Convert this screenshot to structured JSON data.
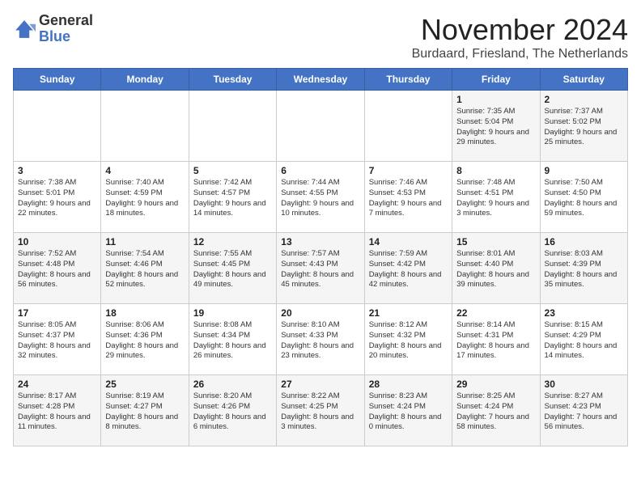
{
  "header": {
    "logo_line1": "General",
    "logo_line2": "Blue",
    "month_title": "November 2024",
    "subtitle": "Burdaard, Friesland, The Netherlands"
  },
  "weekdays": [
    "Sunday",
    "Monday",
    "Tuesday",
    "Wednesday",
    "Thursday",
    "Friday",
    "Saturday"
  ],
  "weeks": [
    [
      {
        "day": "",
        "info": ""
      },
      {
        "day": "",
        "info": ""
      },
      {
        "day": "",
        "info": ""
      },
      {
        "day": "",
        "info": ""
      },
      {
        "day": "",
        "info": ""
      },
      {
        "day": "1",
        "info": "Sunrise: 7:35 AM\nSunset: 5:04 PM\nDaylight: 9 hours and 29 minutes."
      },
      {
        "day": "2",
        "info": "Sunrise: 7:37 AM\nSunset: 5:02 PM\nDaylight: 9 hours and 25 minutes."
      }
    ],
    [
      {
        "day": "3",
        "info": "Sunrise: 7:38 AM\nSunset: 5:01 PM\nDaylight: 9 hours and 22 minutes."
      },
      {
        "day": "4",
        "info": "Sunrise: 7:40 AM\nSunset: 4:59 PM\nDaylight: 9 hours and 18 minutes."
      },
      {
        "day": "5",
        "info": "Sunrise: 7:42 AM\nSunset: 4:57 PM\nDaylight: 9 hours and 14 minutes."
      },
      {
        "day": "6",
        "info": "Sunrise: 7:44 AM\nSunset: 4:55 PM\nDaylight: 9 hours and 10 minutes."
      },
      {
        "day": "7",
        "info": "Sunrise: 7:46 AM\nSunset: 4:53 PM\nDaylight: 9 hours and 7 minutes."
      },
      {
        "day": "8",
        "info": "Sunrise: 7:48 AM\nSunset: 4:51 PM\nDaylight: 9 hours and 3 minutes."
      },
      {
        "day": "9",
        "info": "Sunrise: 7:50 AM\nSunset: 4:50 PM\nDaylight: 8 hours and 59 minutes."
      }
    ],
    [
      {
        "day": "10",
        "info": "Sunrise: 7:52 AM\nSunset: 4:48 PM\nDaylight: 8 hours and 56 minutes."
      },
      {
        "day": "11",
        "info": "Sunrise: 7:54 AM\nSunset: 4:46 PM\nDaylight: 8 hours and 52 minutes."
      },
      {
        "day": "12",
        "info": "Sunrise: 7:55 AM\nSunset: 4:45 PM\nDaylight: 8 hours and 49 minutes."
      },
      {
        "day": "13",
        "info": "Sunrise: 7:57 AM\nSunset: 4:43 PM\nDaylight: 8 hours and 45 minutes."
      },
      {
        "day": "14",
        "info": "Sunrise: 7:59 AM\nSunset: 4:42 PM\nDaylight: 8 hours and 42 minutes."
      },
      {
        "day": "15",
        "info": "Sunrise: 8:01 AM\nSunset: 4:40 PM\nDaylight: 8 hours and 39 minutes."
      },
      {
        "day": "16",
        "info": "Sunrise: 8:03 AM\nSunset: 4:39 PM\nDaylight: 8 hours and 35 minutes."
      }
    ],
    [
      {
        "day": "17",
        "info": "Sunrise: 8:05 AM\nSunset: 4:37 PM\nDaylight: 8 hours and 32 minutes."
      },
      {
        "day": "18",
        "info": "Sunrise: 8:06 AM\nSunset: 4:36 PM\nDaylight: 8 hours and 29 minutes."
      },
      {
        "day": "19",
        "info": "Sunrise: 8:08 AM\nSunset: 4:34 PM\nDaylight: 8 hours and 26 minutes."
      },
      {
        "day": "20",
        "info": "Sunrise: 8:10 AM\nSunset: 4:33 PM\nDaylight: 8 hours and 23 minutes."
      },
      {
        "day": "21",
        "info": "Sunrise: 8:12 AM\nSunset: 4:32 PM\nDaylight: 8 hours and 20 minutes."
      },
      {
        "day": "22",
        "info": "Sunrise: 8:14 AM\nSunset: 4:31 PM\nDaylight: 8 hours and 17 minutes."
      },
      {
        "day": "23",
        "info": "Sunrise: 8:15 AM\nSunset: 4:29 PM\nDaylight: 8 hours and 14 minutes."
      }
    ],
    [
      {
        "day": "24",
        "info": "Sunrise: 8:17 AM\nSunset: 4:28 PM\nDaylight: 8 hours and 11 minutes."
      },
      {
        "day": "25",
        "info": "Sunrise: 8:19 AM\nSunset: 4:27 PM\nDaylight: 8 hours and 8 minutes."
      },
      {
        "day": "26",
        "info": "Sunrise: 8:20 AM\nSunset: 4:26 PM\nDaylight: 8 hours and 6 minutes."
      },
      {
        "day": "27",
        "info": "Sunrise: 8:22 AM\nSunset: 4:25 PM\nDaylight: 8 hours and 3 minutes."
      },
      {
        "day": "28",
        "info": "Sunrise: 8:23 AM\nSunset: 4:24 PM\nDaylight: 8 hours and 0 minutes."
      },
      {
        "day": "29",
        "info": "Sunrise: 8:25 AM\nSunset: 4:24 PM\nDaylight: 7 hours and 58 minutes."
      },
      {
        "day": "30",
        "info": "Sunrise: 8:27 AM\nSunset: 4:23 PM\nDaylight: 7 hours and 56 minutes."
      }
    ]
  ]
}
